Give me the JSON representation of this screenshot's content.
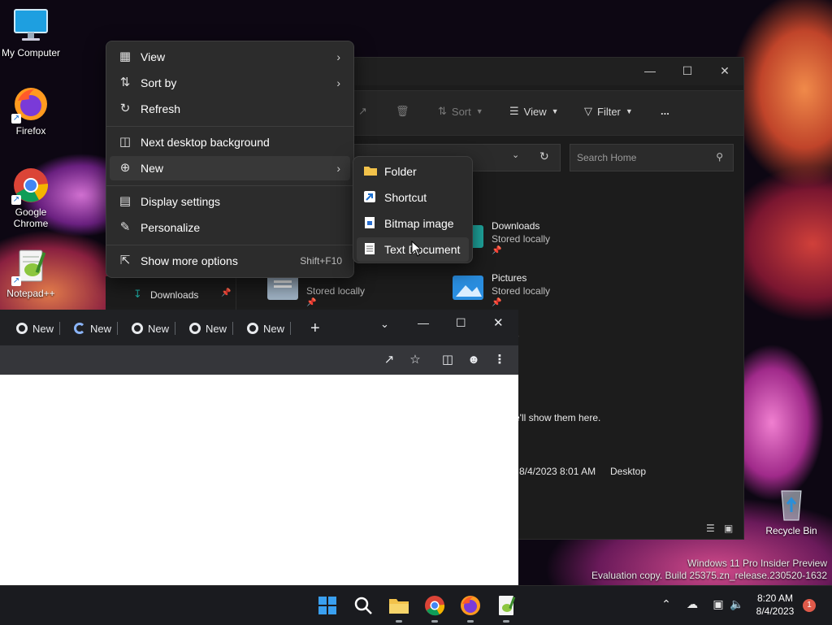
{
  "desktop": {
    "icons": [
      {
        "label": "My Computer"
      },
      {
        "label": "Firefox"
      },
      {
        "label": "Google Chrome"
      },
      {
        "label": "Notepad++"
      },
      {
        "label": "Recycle Bin"
      }
    ],
    "watermark": {
      "line1": "Windows 11 Pro Insider Preview",
      "line2": "Evaluation copy. Build 25375.zn_release.230520-1632"
    }
  },
  "context_menu": {
    "items": [
      {
        "label": "View",
        "icon": "grid-icon",
        "has_submenu": true
      },
      {
        "label": "Sort by",
        "icon": "sort-icon",
        "has_submenu": true
      },
      {
        "label": "Refresh",
        "icon": "refresh-icon"
      },
      {
        "label": "Next desktop background",
        "icon": "background-icon"
      },
      {
        "label": "New",
        "icon": "plus-circle-icon",
        "has_submenu": true,
        "highlighted": true
      },
      {
        "label": "Display settings",
        "icon": "display-icon"
      },
      {
        "label": "Personalize",
        "icon": "brush-icon"
      },
      {
        "label": "Show more options",
        "icon": "more-options-icon",
        "shortcut": "Shift+F10"
      }
    ]
  },
  "new_submenu": {
    "items": [
      {
        "label": "Folder",
        "icon": "folder-icon"
      },
      {
        "label": "Shortcut",
        "icon": "shortcut-icon"
      },
      {
        "label": "Bitmap image",
        "icon": "bitmap-icon"
      },
      {
        "label": "Text Document",
        "icon": "text-document-icon",
        "highlighted": true
      }
    ]
  },
  "explorer": {
    "toolbar": {
      "sort_label": "Sort",
      "view_label": "View",
      "filter_label": "Filter",
      "more_label": "..."
    },
    "search_placeholder": "Search Home",
    "quick_access": [
      {
        "name": "Downloads",
        "status": "Stored locally"
      },
      {
        "name": "Pictures",
        "status": "Stored locally"
      },
      {
        "name": "",
        "status": "Stored locally"
      },
      {
        "name": "",
        "status": "locally"
      }
    ],
    "nav_downloads": "Downloads",
    "empty_message": "e'll show them here.",
    "recent_row": {
      "date": "8/4/2023 8:01 AM",
      "location": "Desktop"
    }
  },
  "chrome": {
    "tabs": [
      {
        "label": "New"
      },
      {
        "label": "New"
      },
      {
        "label": "New"
      },
      {
        "label": "New"
      },
      {
        "label": "New"
      }
    ],
    "new_tab_label": "+"
  },
  "taskbar": {
    "apps": [
      "start-icon",
      "search-icon",
      "file-explorer-icon",
      "chrome-icon",
      "firefox-icon",
      "notepadpp-icon"
    ],
    "time": "8:20 AM",
    "date": "8/4/2023",
    "notification_count": "1"
  },
  "colors": {
    "menu_bg": "#2c2c2c",
    "accent_blue": "#0078d4",
    "taskbar_bg": "#1a1b1f"
  }
}
